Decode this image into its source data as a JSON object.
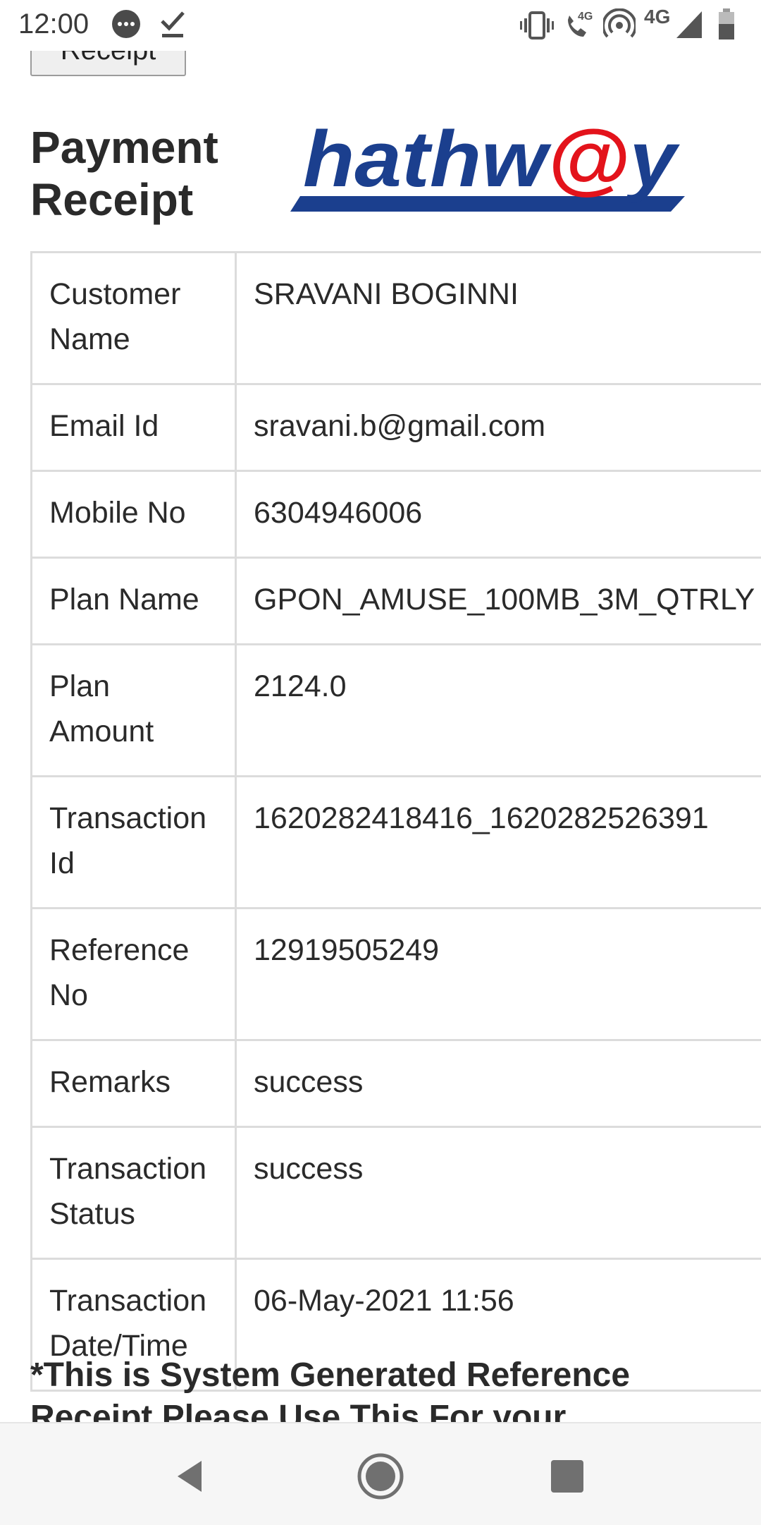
{
  "status_bar": {
    "time": "12:00",
    "network_label": "4G",
    "volte_label": "4G"
  },
  "receipt_button": {
    "label": "Receipt"
  },
  "page": {
    "title": "Payment Receipt"
  },
  "logo": {
    "text": "hathw@y"
  },
  "rows": [
    {
      "label": "Customer Name",
      "value": "SRAVANI BOGINNI"
    },
    {
      "label": "Email Id",
      "value": "sravani.b@gmail.com"
    },
    {
      "label": "Mobile No",
      "value": "6304946006"
    },
    {
      "label": "Plan Name",
      "value": "GPON_AMUSE_100MB_3M_QTRLY"
    },
    {
      "label": "Plan Amount",
      "value": "2124.0"
    },
    {
      "label": "Transaction Id",
      "value": "1620282418416_1620282526391"
    },
    {
      "label": "Reference No",
      "value": "12919505249"
    },
    {
      "label": "Remarks",
      "value": "success"
    },
    {
      "label": "Transaction Status",
      "value": "success"
    },
    {
      "label": "Transaction Date/Time",
      "value": "06-May-2021 11:56"
    }
  ],
  "footnote": "*This is System Generated Reference Receipt.Please Use This For your",
  "icons": {
    "status": [
      "message-bubble-icon",
      "download-done-icon",
      "vibrate-icon",
      "volte-call-icon",
      "hotspot-icon",
      "signal-icon",
      "battery-icon"
    ],
    "nav": [
      "back-icon",
      "home-icon",
      "recents-icon"
    ]
  },
  "colors": {
    "logo_blue": "#1b3f8e",
    "logo_red": "#e3131b"
  }
}
